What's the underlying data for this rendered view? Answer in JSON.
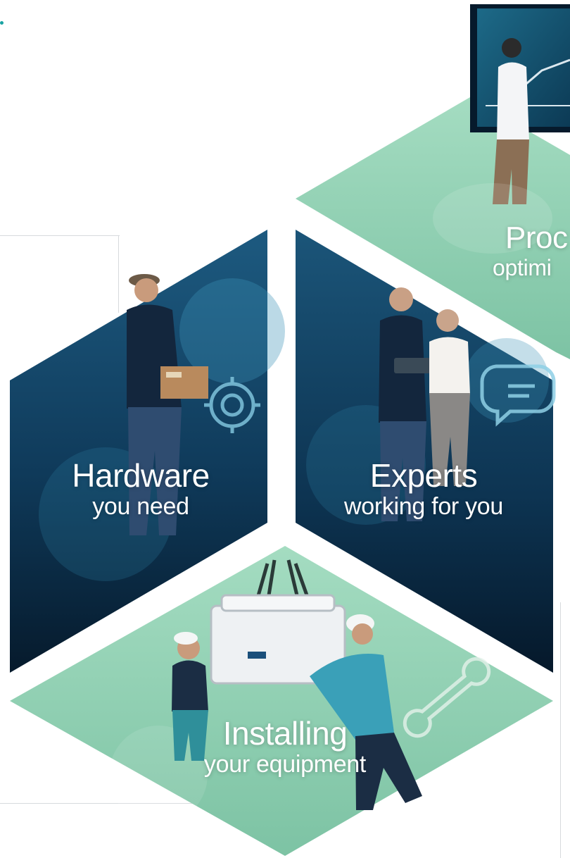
{
  "colors": {
    "mint": "#8fcfb0",
    "mint_dark": "#6fb89a",
    "navy": "#0c2a45",
    "navy_light": "#1b4f73",
    "accent": "#1aa3a3"
  },
  "tiles": {
    "productivity": {
      "title": "Proc",
      "subtitle": "optimi",
      "icon": "presentation-icon"
    },
    "hardware": {
      "title": "Hardware",
      "subtitle": "you need",
      "icon": "gear-icon"
    },
    "experts": {
      "title": "Experts",
      "subtitle": "working for you",
      "icon": "chat-bubble-icon"
    },
    "installing": {
      "title": "Installing",
      "subtitle": "your equipment",
      "icon": "wrench-icon"
    }
  }
}
